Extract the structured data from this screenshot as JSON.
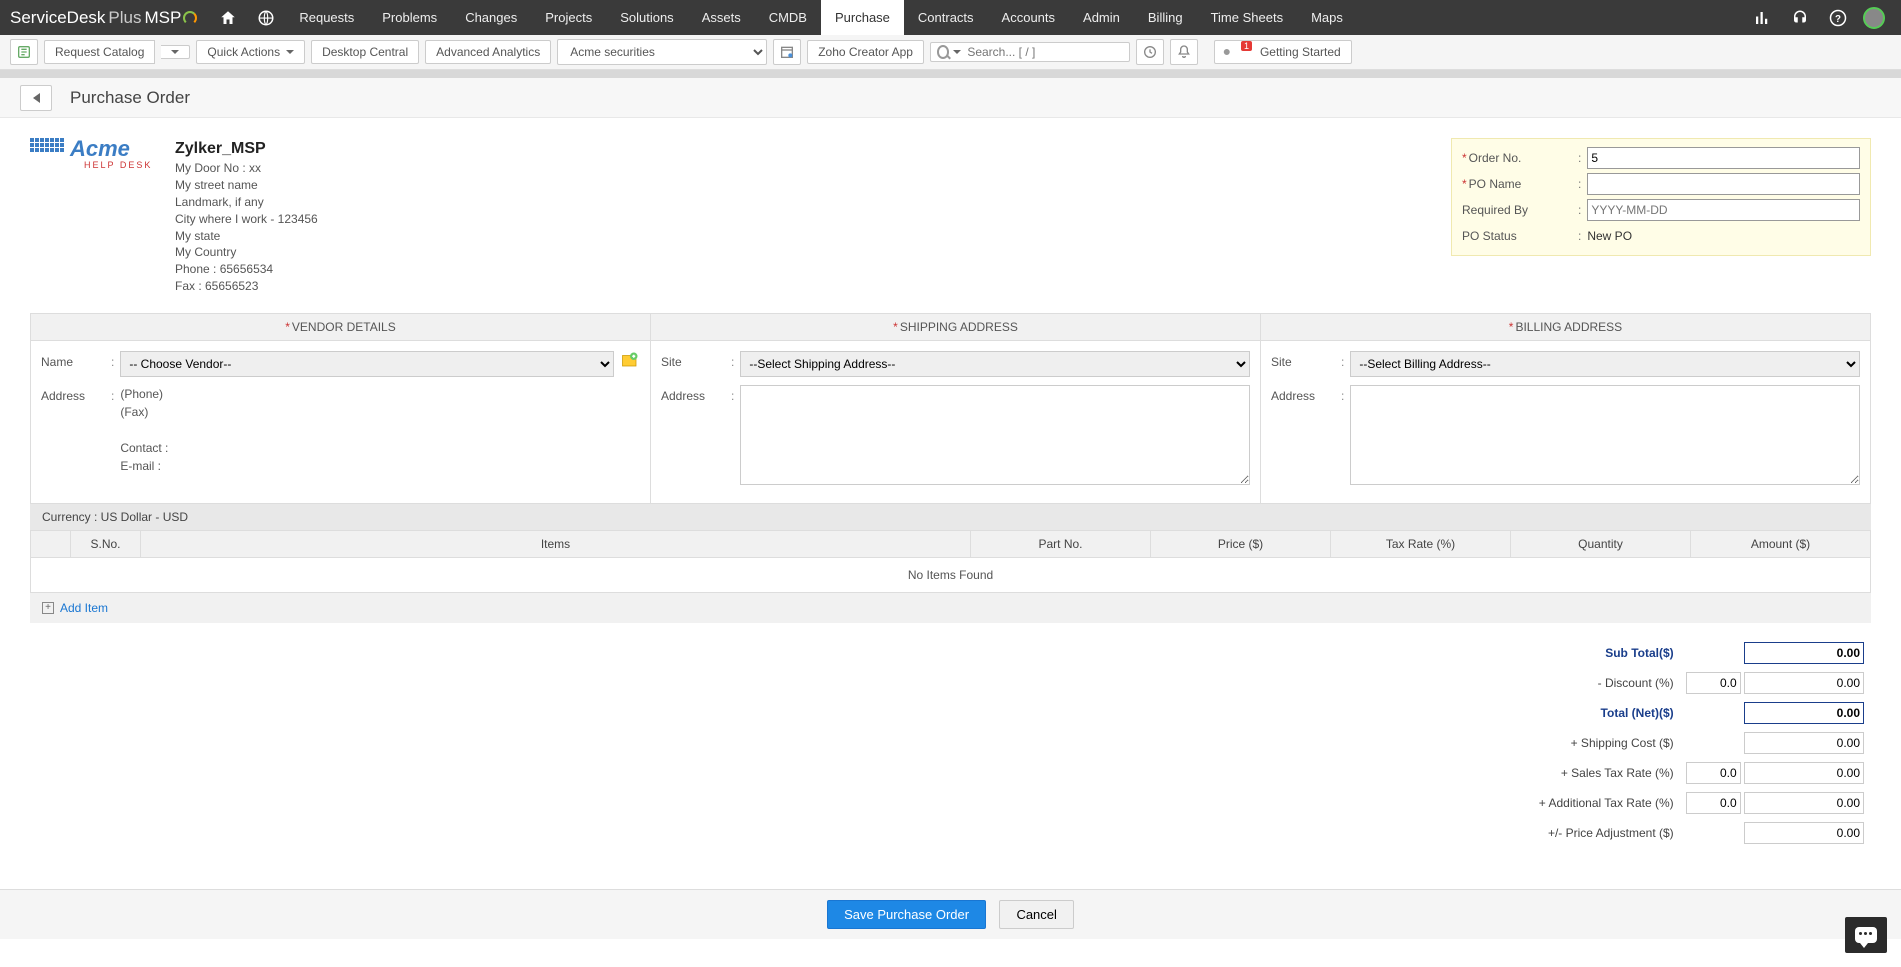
{
  "brand": {
    "service": "ServiceDesk",
    "plus": "Plus",
    "msp": "MSP"
  },
  "nav": {
    "tabs": [
      "Requests",
      "Problems",
      "Changes",
      "Projects",
      "Solutions",
      "Assets",
      "CMDB",
      "Purchase",
      "Contracts",
      "Accounts",
      "Admin",
      "Billing",
      "Time Sheets",
      "Maps"
    ],
    "active": "Purchase"
  },
  "toolbar": {
    "request_catalog": "Request Catalog",
    "quick_actions": "Quick Actions",
    "desktop_central": "Desktop Central",
    "advanced_analytics": "Advanced Analytics",
    "org_selected": "Acme securities",
    "zoho_creator": "Zoho Creator App",
    "search_placeholder": "Search... [ / ]",
    "getting_started": "Getting Started",
    "getting_started_badge": "1"
  },
  "page": {
    "title": "Purchase Order"
  },
  "company": {
    "name": "Zylker_MSP",
    "lines": [
      "My Door No : xx",
      "My street name",
      "Landmark, if any",
      "City where I work - 123456",
      "My state",
      "My Country",
      "Phone : 65656534",
      "Fax : 65656523"
    ]
  },
  "po": {
    "order_no_label": "Order No.",
    "order_no_value": "5",
    "po_name_label": "PO Name",
    "po_name_value": "",
    "required_by_label": "Required By",
    "required_by_placeholder": "YYYY-MM-DD",
    "status_label": "PO Status",
    "status_value": "New PO"
  },
  "sections": {
    "vendor": {
      "title": "VENDOR DETAILS",
      "name_label": "Name",
      "addr_label": "Address",
      "choose": "-- Choose Vendor--",
      "phone": "(Phone)",
      "fax": "(Fax)",
      "contact": "Contact :",
      "email": "E-mail :"
    },
    "shipping": {
      "title": "SHIPPING ADDRESS",
      "site_label": "Site",
      "select": "--Select Shipping Address--",
      "addr_label": "Address"
    },
    "billing": {
      "title": "BILLING ADDRESS",
      "site_label": "Site",
      "select": "--Select Billing Address--",
      "addr_label": "Address"
    }
  },
  "currency_line": "Currency : US Dollar - USD",
  "items": {
    "cols": [
      "",
      "S.No.",
      "Items",
      "Part No.",
      "Price ($)",
      "Tax Rate  (%)",
      "Quantity",
      "Amount  ($)"
    ],
    "empty": "No Items Found",
    "add": "Add Item"
  },
  "totals": {
    "subtotal_label": "Sub Total($)",
    "subtotal_val": "0.00",
    "discount_label": "- Discount (%)",
    "discount_pct": "0.0",
    "discount_val": "0.00",
    "net_label": "Total (Net)($)",
    "net_val": "0.00",
    "shipping_label": "+ Shipping Cost ($)",
    "shipping_val": "0.00",
    "sales_label": "+ Sales Tax Rate (%)",
    "sales_pct": "0.0",
    "sales_val": "0.00",
    "addl_label": "+ Additional Tax Rate  (%)",
    "addl_pct": "0.0",
    "addl_val": "0.00",
    "adj_label": "+/- Price Adjustment ($)",
    "adj_val": "0.00"
  },
  "buttons": {
    "save": "Save Purchase Order",
    "cancel": "Cancel"
  }
}
